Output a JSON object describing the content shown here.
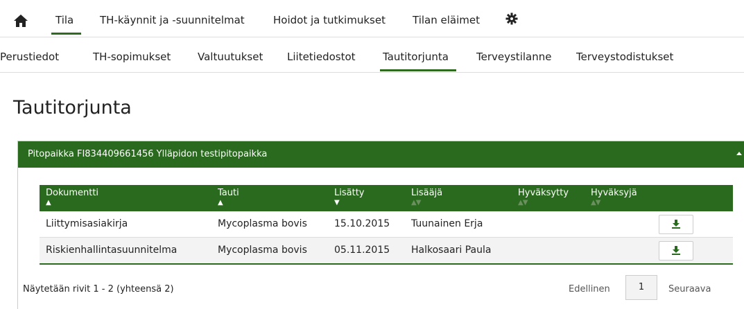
{
  "top_nav": {
    "items": [
      {
        "label": "Tila"
      },
      {
        "label": "TH-käynnit ja -suunnitelmat"
      },
      {
        "label": "Hoidot ja tutkimukset"
      },
      {
        "label": "Tilan eläimet"
      }
    ],
    "active": "Tila"
  },
  "sub_nav": {
    "items": [
      {
        "label": "Perustiedot"
      },
      {
        "label": "TH-sopimukset"
      },
      {
        "label": "Valtuutukset"
      },
      {
        "label": "Liitetiedostot"
      },
      {
        "label": "Tautitorjunta"
      },
      {
        "label": "Terveystilanne"
      },
      {
        "label": "Terveystodistukset"
      }
    ],
    "active": "Tautitorjunta"
  },
  "page_title": "Tautitorjunta",
  "panel": {
    "title": "Pitopaikka FI834409661456 Ylläpidon testipitopaikka"
  },
  "table": {
    "columns": [
      {
        "label": "Dokumentti",
        "sort": "▲"
      },
      {
        "label": "Tauti",
        "sort": "▲"
      },
      {
        "label": "Lisätty",
        "sort": "▼"
      },
      {
        "label": "Lisääjä",
        "sort": "▲▼"
      },
      {
        "label": "Hyväksytty",
        "sort": "▲▼"
      },
      {
        "label": "Hyväksyjä",
        "sort": "▲▼"
      }
    ],
    "rows": [
      {
        "dokumentti": "Liittymisasiakirja",
        "tauti": "Mycoplasma bovis",
        "lisatty": "15.10.2015",
        "lisaaja": "Tuunainen Erja",
        "hyvaksytty": "",
        "hyvaksyja": ""
      },
      {
        "dokumentti": "Riskienhallintasuunnitelma",
        "tauti": "Mycoplasma bovis",
        "lisatty": "05.11.2015",
        "lisaaja": "Halkosaari Paula",
        "hyvaksytty": "",
        "hyvaksyja": ""
      }
    ]
  },
  "footer": {
    "info": "Näytetään rivit 1 - 2 (yhteensä 2)",
    "prev": "Edellinen",
    "page": "1",
    "next": "Seuraava"
  },
  "colors": {
    "accent": "#2a6a1e"
  },
  "icons": {
    "home": "home-icon",
    "settings": "gear-icon",
    "download": "download-icon",
    "collapse": "caret-up-icon"
  }
}
